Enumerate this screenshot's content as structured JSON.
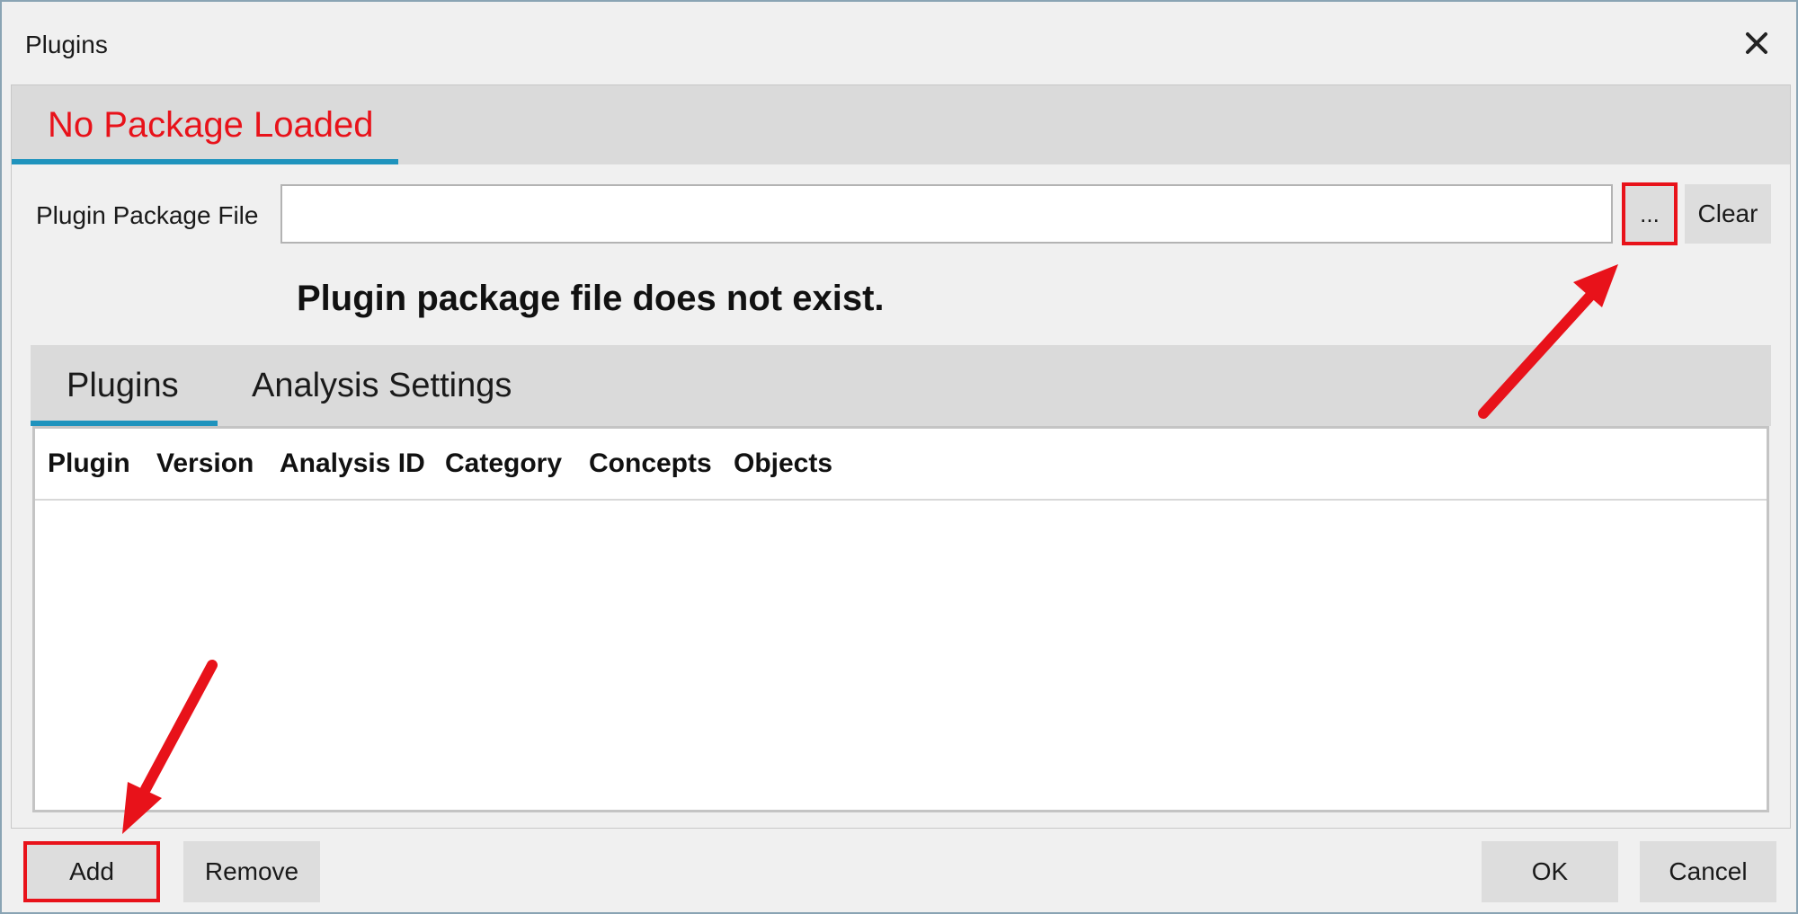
{
  "window": {
    "title": "Plugins",
    "close_icon": "close-icon"
  },
  "package": {
    "tab_label": "No Package Loaded",
    "tab_label_color": "#e8121a",
    "file_label": "Plugin Package File",
    "file_value": "",
    "browse_label": "...",
    "clear_label": "Clear",
    "status_message": "Plugin package file does not exist."
  },
  "tabs": [
    {
      "label": "Plugins",
      "active": true
    },
    {
      "label": "Analysis Settings",
      "active": false
    }
  ],
  "table": {
    "columns": [
      "Plugin",
      "Version",
      "Analysis ID",
      "Category",
      "Concepts",
      "Objects"
    ],
    "rows": []
  },
  "buttons": {
    "add": "Add",
    "remove": "Remove",
    "ok": "OK",
    "cancel": "Cancel"
  },
  "colors": {
    "accent": "#1f93bd",
    "highlight": "#e8121a"
  }
}
